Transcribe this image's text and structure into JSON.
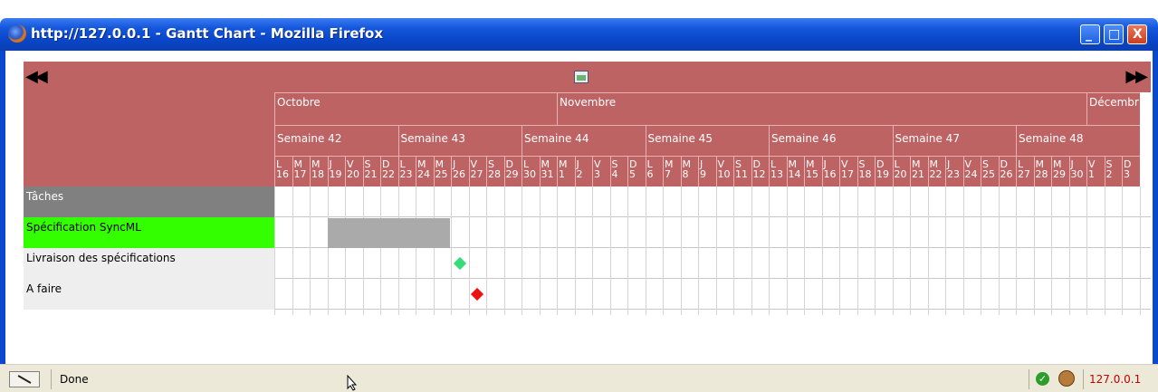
{
  "window": {
    "title": "http://127.0.0.1 - Gantt Chart - Mozilla Firefox",
    "buttons": {
      "minimize": "_",
      "maximize": "□",
      "close": "X"
    }
  },
  "gantt": {
    "nav_prev": "◀◀",
    "nav_next": "▶▶",
    "months": [
      "Octobre",
      "Novembre",
      "Décembr"
    ],
    "weeks": [
      "Semaine 42",
      "Semaine 43",
      "Semaine 44",
      "Semaine 45",
      "Semaine 46",
      "Semaine 47",
      "Semaine 48"
    ],
    "day_letters": [
      "L",
      "M",
      "M",
      "J",
      "V",
      "S",
      "D"
    ],
    "day_numbers": [
      "16",
      "17",
      "18",
      "19",
      "20",
      "21",
      "22",
      "23",
      "24",
      "25",
      "26",
      "27",
      "28",
      "29",
      "30",
      "31",
      "1",
      "2",
      "3",
      "4",
      "5",
      "6",
      "7",
      "8",
      "9",
      "10",
      "11",
      "12",
      "13",
      "14",
      "15",
      "16",
      "17",
      "18",
      "19",
      "20",
      "21",
      "22",
      "23",
      "24",
      "25",
      "26",
      "27",
      "28",
      "29",
      "30",
      "1",
      "2",
      "3"
    ],
    "tasks": [
      {
        "label": "Tâches",
        "bg": "#808080",
        "fg": "#ffffff"
      },
      {
        "label": "Spécification SyncML",
        "bg": "#33ff00",
        "fg": "#000000"
      },
      {
        "label": "Livraison des spécifications",
        "bg": "#eeeeee",
        "fg": "#000000"
      },
      {
        "label": "A faire",
        "bg": "#eeeeee",
        "fg": "#000000"
      }
    ],
    "bar": {
      "task": "Spécification SyncML",
      "start": "19",
      "end": "25",
      "color": "#aaaaaa"
    },
    "milestones": [
      {
        "task": "Livraison des spécifications",
        "day": "26",
        "color": "#33dd77"
      },
      {
        "task": "A faire",
        "day": "27",
        "color": "#ee1111"
      }
    ],
    "header_color": "#be6363"
  },
  "statusbar": {
    "text": "Done",
    "host": "127.0.0.1"
  }
}
